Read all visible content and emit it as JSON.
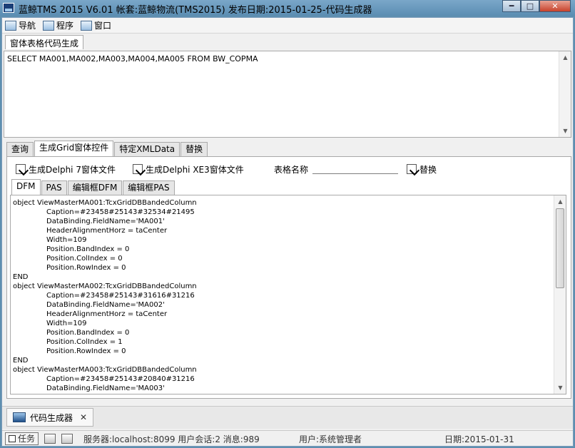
{
  "window": {
    "title": "蓝鲸TMS 2015 V6.01 帐套:蓝鲸物流(TMS2015) 发布日期:2015-01-25-代码生成器",
    "min_label": "━",
    "max_label": "□",
    "close_label": "✕"
  },
  "menubar": {
    "items": [
      {
        "label": "导航",
        "icon": "navigation-icon"
      },
      {
        "label": "程序",
        "icon": "program-icon"
      },
      {
        "label": "窗口",
        "icon": "window-icon"
      }
    ]
  },
  "doc_tab": {
    "label": "窗体表格代码生成"
  },
  "sql": {
    "text": "SELECT MA001,MA002,MA003,MA004,MA005 FROM BW_COPMA"
  },
  "main_tabs": [
    {
      "label": "查询",
      "active": false
    },
    {
      "label": "生成Grid窗体控件",
      "active": true
    },
    {
      "label": "特定XMLData",
      "active": false
    },
    {
      "label": "替换",
      "active": false
    }
  ],
  "actions": {
    "gen_d7": "生成Delphi 7窗体文件",
    "gen_xe3": "生成Delphi XE3窗体文件",
    "table_name_label": "表格名称",
    "table_name_value": "",
    "replace": "替换"
  },
  "sub_tabs": [
    {
      "label": "DFM",
      "active": true
    },
    {
      "label": "PAS",
      "active": false
    },
    {
      "label": "编辑框DFM",
      "active": false
    },
    {
      "label": "编辑框PAS",
      "active": false
    }
  ],
  "code_lines": [
    "object ViewMasterMA001:TcxGridDBBandedColumn",
    "Caption=#23458#25143#32534#21495",
    "DataBinding.FieldName='MA001'",
    "HeaderAlignmentHorz = taCenter",
    "Width=109",
    "Position.BandIndex = 0",
    "Position.ColIndex = 0",
    "Position.RowIndex = 0",
    "END",
    "object ViewMasterMA002:TcxGridDBBandedColumn",
    "Caption=#23458#25143#31616#31216",
    "DataBinding.FieldName='MA002'",
    "HeaderAlignmentHorz = taCenter",
    "Width=109",
    "Position.BandIndex = 0",
    "Position.ColIndex = 1",
    "Position.RowIndex = 0",
    "END",
    "object ViewMasterMA003:TcxGridDBBandedColumn",
    "Caption=#23458#25143#20840#31216",
    "DataBinding.FieldName='MA003'"
  ],
  "bottom_tab": {
    "label": "代码生成器",
    "close": "✕"
  },
  "status": {
    "task": "任务",
    "server": "服务器:localhost:8099 用户会话:2 消息:989",
    "user": "用户:系统管理者",
    "date": "日期:2015-01-31"
  }
}
